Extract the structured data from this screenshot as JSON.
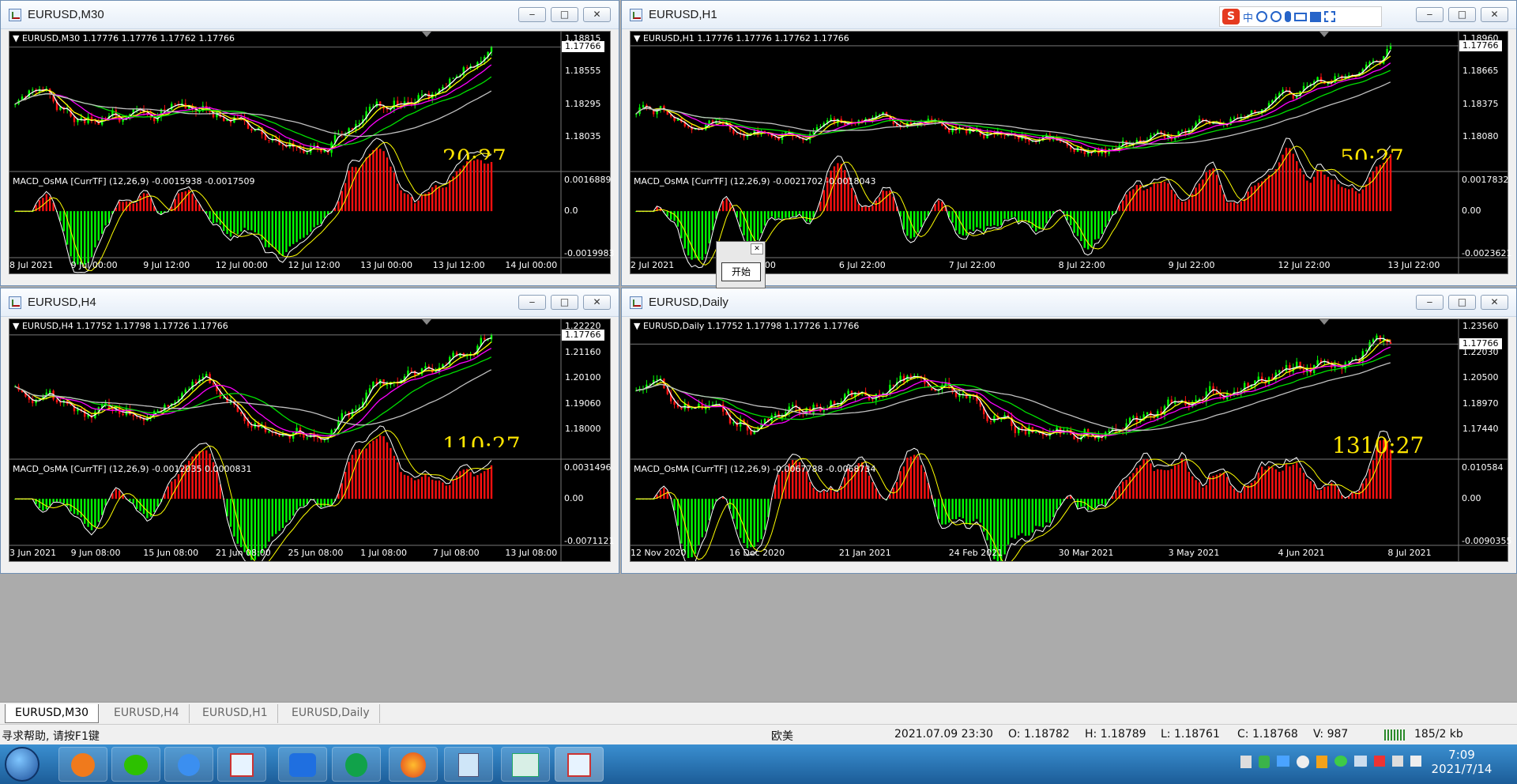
{
  "windows": [
    {
      "id": "w0",
      "title": "EURUSD,M30",
      "info": "EURUSD,M30  1.17776 1.17776 1.17762 1.17766",
      "prices": [
        "1.18815",
        "1.18555",
        "1.18295",
        "1.18035",
        "1.17766"
      ],
      "macd_title": "MACD_OsMA [CurrTF] (12,26,9) -0.0015938 -0.0017509",
      "macd_scale": [
        "0.0016889",
        "0.0",
        "-0.0019983"
      ],
      "x_labels": [
        "8 Jul 2021",
        "9 Jul 00:00",
        "9 Jul 12:00",
        "12 Jul 00:00",
        "12 Jul 12:00",
        "13 Jul 00:00",
        "13 Jul 12:00",
        "14 Jul 00:00"
      ],
      "timer": "20:27",
      "seed": 11
    },
    {
      "id": "w1",
      "title": "EURUSD,H1",
      "info": "EURUSD,H1  1.17776 1.17776 1.17762 1.17766",
      "prices": [
        "1.18960",
        "1.18665",
        "1.18375",
        "1.18080",
        "1.17766"
      ],
      "macd_title": "MACD_OsMA [CurrTF] (12,26,9) -0.0021702 -0.0018043",
      "macd_scale": [
        "0.0017832",
        "0.00",
        "-0.0023621"
      ],
      "x_labels": [
        "2 Jul 2021",
        "5 Jul 22:00",
        "6 Jul 22:00",
        "7 Jul 22:00",
        "8 Jul 22:00",
        "9 Jul 22:00",
        "12 Jul 22:00",
        "13 Jul 22:00"
      ],
      "timer": "50:27",
      "seed": 23
    },
    {
      "id": "w2",
      "title": "EURUSD,H4",
      "info": "EURUSD,H4  1.17752 1.17798 1.17726 1.17766",
      "prices": [
        "1.22220",
        "1.21160",
        "1.20100",
        "1.19060",
        "1.18000",
        "1.17766"
      ],
      "macd_title": "MACD_OsMA [CurrTF] (12,26,9) -0.0012035 0.0000831",
      "macd_scale": [
        "0.0031496",
        "0.00",
        "-0.0071121"
      ],
      "x_labels": [
        "3 Jun 2021",
        "9 Jun 08:00",
        "15 Jun 08:00",
        "21 Jun 08:00",
        "25 Jun 08:00",
        "1 Jul 08:00",
        "7 Jul 08:00",
        "13 Jul 08:00"
      ],
      "timer": "110:27",
      "seed": 37
    },
    {
      "id": "w3",
      "title": "EURUSD,Daily",
      "info": "EURUSD,Daily  1.17752 1.17798 1.17726 1.17766",
      "prices": [
        "1.23560",
        "1.22030",
        "1.20500",
        "1.18970",
        "1.17440",
        "1.17766"
      ],
      "macd_title": "MACD_OsMA [CurrTF] (12,26,9) -0.0067788 -0.0068734",
      "macd_scale": [
        "0.010584",
        "0.00",
        "-0.0090355"
      ],
      "x_labels": [
        "12 Nov 2020",
        "16 Dec 2020",
        "21 Jan 2021",
        "24 Feb 2021",
        "30 Mar 2021",
        "3 May 2021",
        "4 Jun 2021",
        "8 Jul 2021"
      ],
      "timer": "1310:27",
      "seed": 53
    }
  ],
  "win_buttons": {
    "min": "‒",
    "max": "□",
    "close": "✕"
  },
  "popup": {
    "close": "✕",
    "button": "开始"
  },
  "ime": {
    "logo": "S",
    "mode": "中"
  },
  "tabs": [
    "EURUSD,M30",
    "EURUSD,H4",
    "EURUSD,H1",
    "EURUSD,Daily"
  ],
  "status": {
    "help": "寻求帮助, 请按F1键",
    "profile": "欧美",
    "datetime": "2021.07.09 23:30",
    "open": "O: 1.18782",
    "high": "H: 1.18789",
    "low": "L: 1.18761",
    "close": "C: 1.18768",
    "volume": "V: 987",
    "traffic": "185/2 kb"
  },
  "clock": {
    "time": "7:09",
    "date": "2021/7/14"
  },
  "taskbar_apps": [
    "start-orb",
    "app-orange-icon",
    "wechat-icon",
    "feather-pen-icon",
    "mt4-chart-icon",
    "lanxin-icon",
    "green-app-icon",
    "firefox-icon",
    "notepad-icon",
    "trader-app-icon",
    "mt4-chart-icon"
  ],
  "colors": {
    "bull": "#00ff00",
    "bear": "#ff1010",
    "ma_fast": "#ffffff",
    "ma_2": "#ffff00",
    "ma_3": "#ff00ff",
    "ma_4": "#00e000",
    "ma_5": "#c0c0c0",
    "timer": "#ffe600"
  }
}
